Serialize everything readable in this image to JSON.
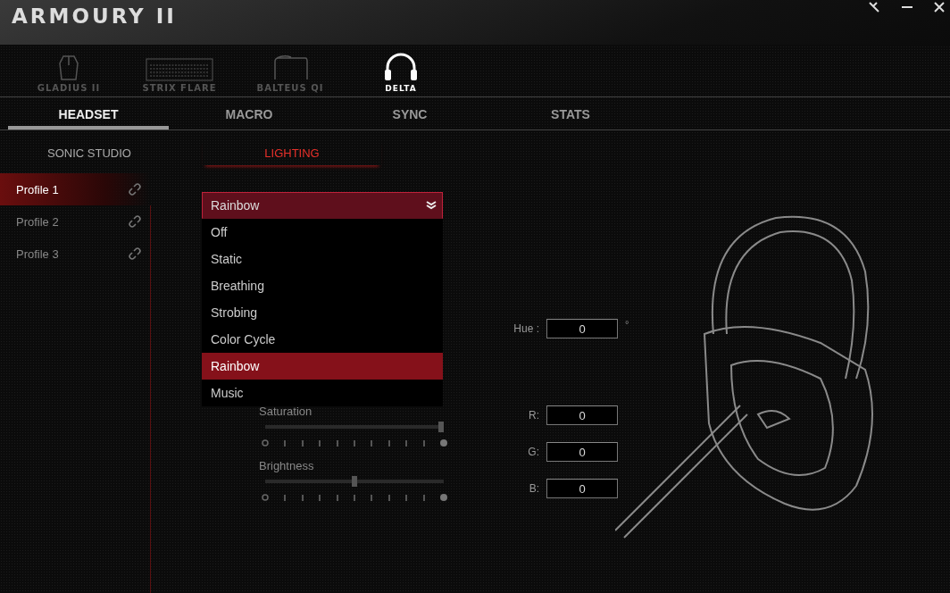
{
  "window": {
    "title": "ARMOURY II"
  },
  "devices": [
    {
      "label": "GLADIUS II",
      "kind": "mouse",
      "selected": false
    },
    {
      "label": "STRIX FLARE",
      "kind": "keyboard",
      "selected": false
    },
    {
      "label": "BALTEUS QI",
      "kind": "mousepad",
      "selected": false
    },
    {
      "label": "DELTA",
      "kind": "headset",
      "selected": true
    }
  ],
  "tabs": [
    {
      "label": "HEADSET",
      "selected": true
    },
    {
      "label": "MACRO",
      "selected": false
    },
    {
      "label": "SYNC",
      "selected": false
    },
    {
      "label": "STATS",
      "selected": false
    }
  ],
  "subtabs": [
    {
      "label": "SONIC STUDIO",
      "selected": false
    },
    {
      "label": "LIGHTING",
      "selected": true
    }
  ],
  "profiles": [
    {
      "label": "Profile 1",
      "selected": true
    },
    {
      "label": "Profile 2",
      "selected": false
    },
    {
      "label": "Profile 3",
      "selected": false
    }
  ],
  "effect_dropdown": {
    "value": "Rainbow",
    "expanded": true,
    "options": [
      {
        "label": "Off",
        "selected": false
      },
      {
        "label": "Static",
        "selected": false
      },
      {
        "label": "Breathing",
        "selected": false
      },
      {
        "label": "Strobing",
        "selected": false
      },
      {
        "label": "Color Cycle",
        "selected": false
      },
      {
        "label": "Rainbow",
        "selected": true
      },
      {
        "label": "Music",
        "selected": false
      }
    ]
  },
  "sliders": [
    {
      "label": "Saturation",
      "level": 1
    },
    {
      "label": "Brightness",
      "level": 0.5
    }
  ],
  "hue": {
    "label": "Hue :",
    "value": "0",
    "unit": "°"
  },
  "rgb": [
    {
      "label": "R:",
      "value": "0"
    },
    {
      "label": "G:",
      "value": "0"
    },
    {
      "label": "B:",
      "value": "0"
    }
  ]
}
